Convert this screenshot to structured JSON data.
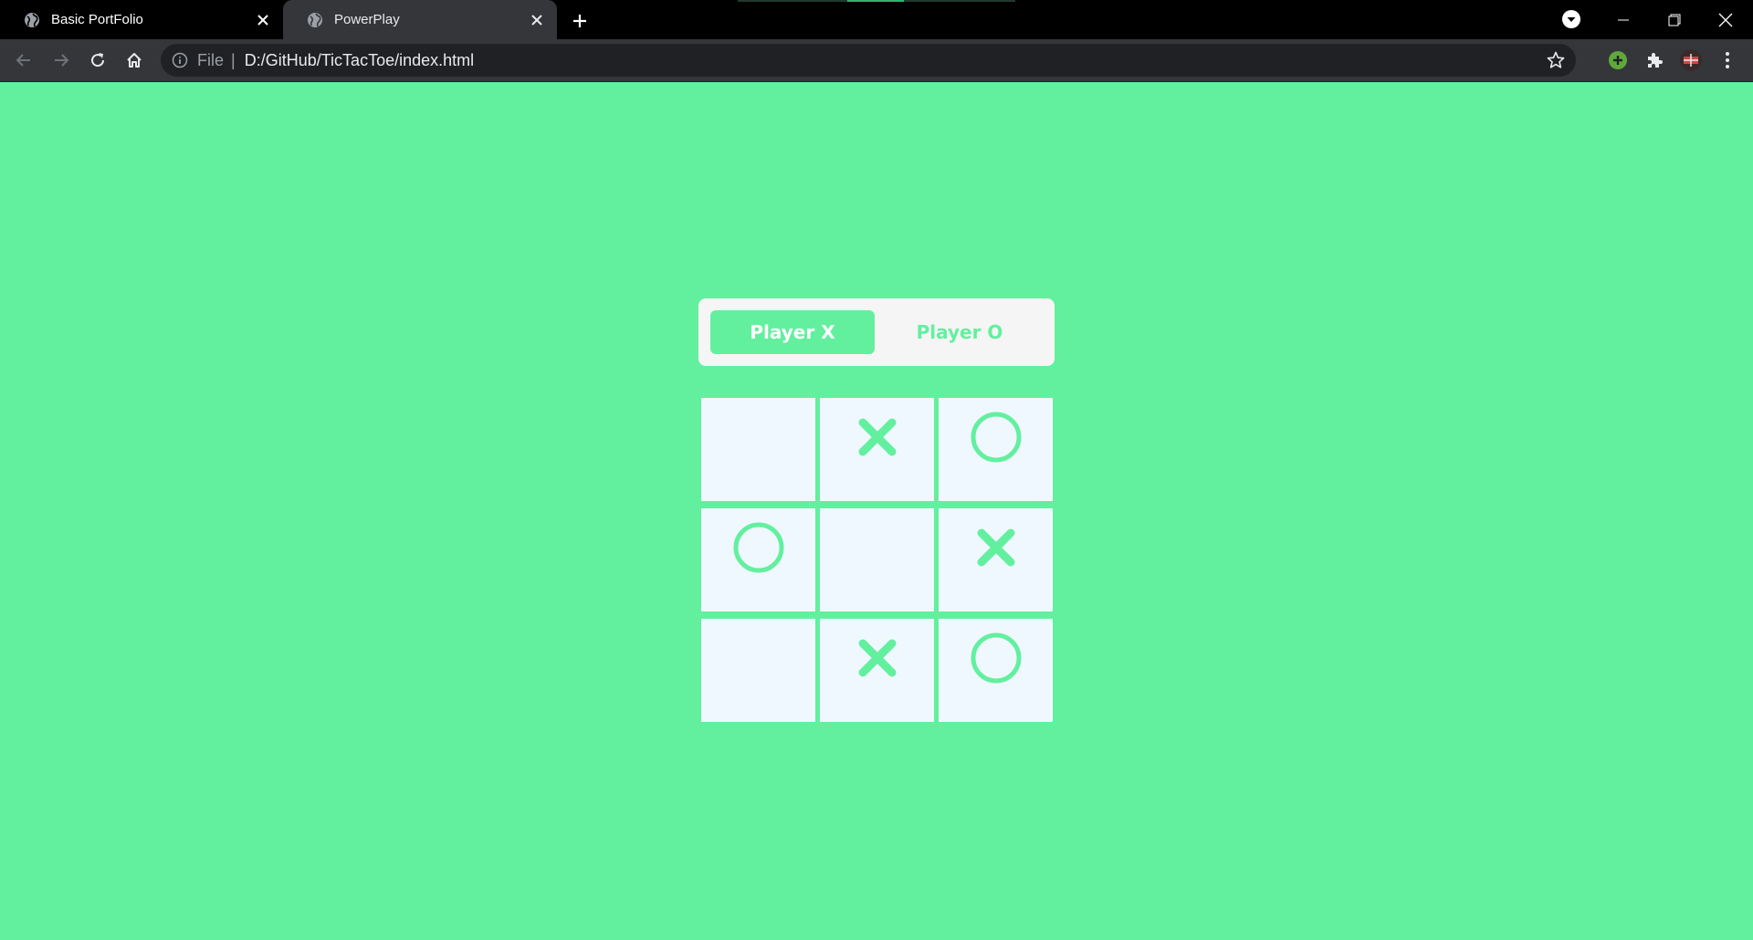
{
  "browser": {
    "tabs": [
      {
        "title": "Basic PortFolio",
        "active": false
      },
      {
        "title": "PowerPlay",
        "active": true
      }
    ],
    "address": {
      "scheme": "File",
      "url": "D:/GitHub/TicTacToe/index.html"
    }
  },
  "colors": {
    "accent": "#62f09f",
    "board_cell": "#f0f8ff",
    "panel": "#f5f5f5"
  },
  "game": {
    "players": [
      {
        "label": "Player X",
        "active": true
      },
      {
        "label": "Player O",
        "active": false
      }
    ],
    "board": [
      "",
      "X",
      "O",
      "O",
      "",
      "X",
      "",
      "X",
      "O"
    ]
  }
}
